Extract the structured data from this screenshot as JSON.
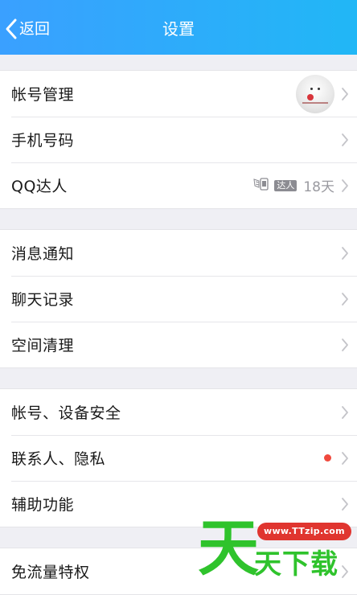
{
  "header": {
    "back_label": "返回",
    "title": "设置"
  },
  "groups": [
    {
      "items": [
        {
          "label": "帐号管理",
          "right": "avatar"
        },
        {
          "label": "手机号码"
        },
        {
          "label": "QQ达人",
          "badge_label": "达人",
          "days": "18天"
        }
      ]
    },
    {
      "items": [
        {
          "label": "消息通知"
        },
        {
          "label": "聊天记录"
        },
        {
          "label": "空间清理"
        }
      ]
    },
    {
      "items": [
        {
          "label": "帐号、设备安全"
        },
        {
          "label": "联系人、隐私",
          "right": "red-dot"
        },
        {
          "label": "辅助功能"
        }
      ]
    },
    {
      "items": [
        {
          "label": "免流量特权"
        }
      ]
    }
  ],
  "watermark": {
    "big_char": "天",
    "url": "www.TTzip.com",
    "text": "天下载"
  },
  "colors": {
    "header_start": "#3aa0ff",
    "header_end": "#21b7f6",
    "background": "#efeff4",
    "red_dot": "#f0493d",
    "watermark_green": "#2fc32c",
    "watermark_red": "#e0352f"
  }
}
